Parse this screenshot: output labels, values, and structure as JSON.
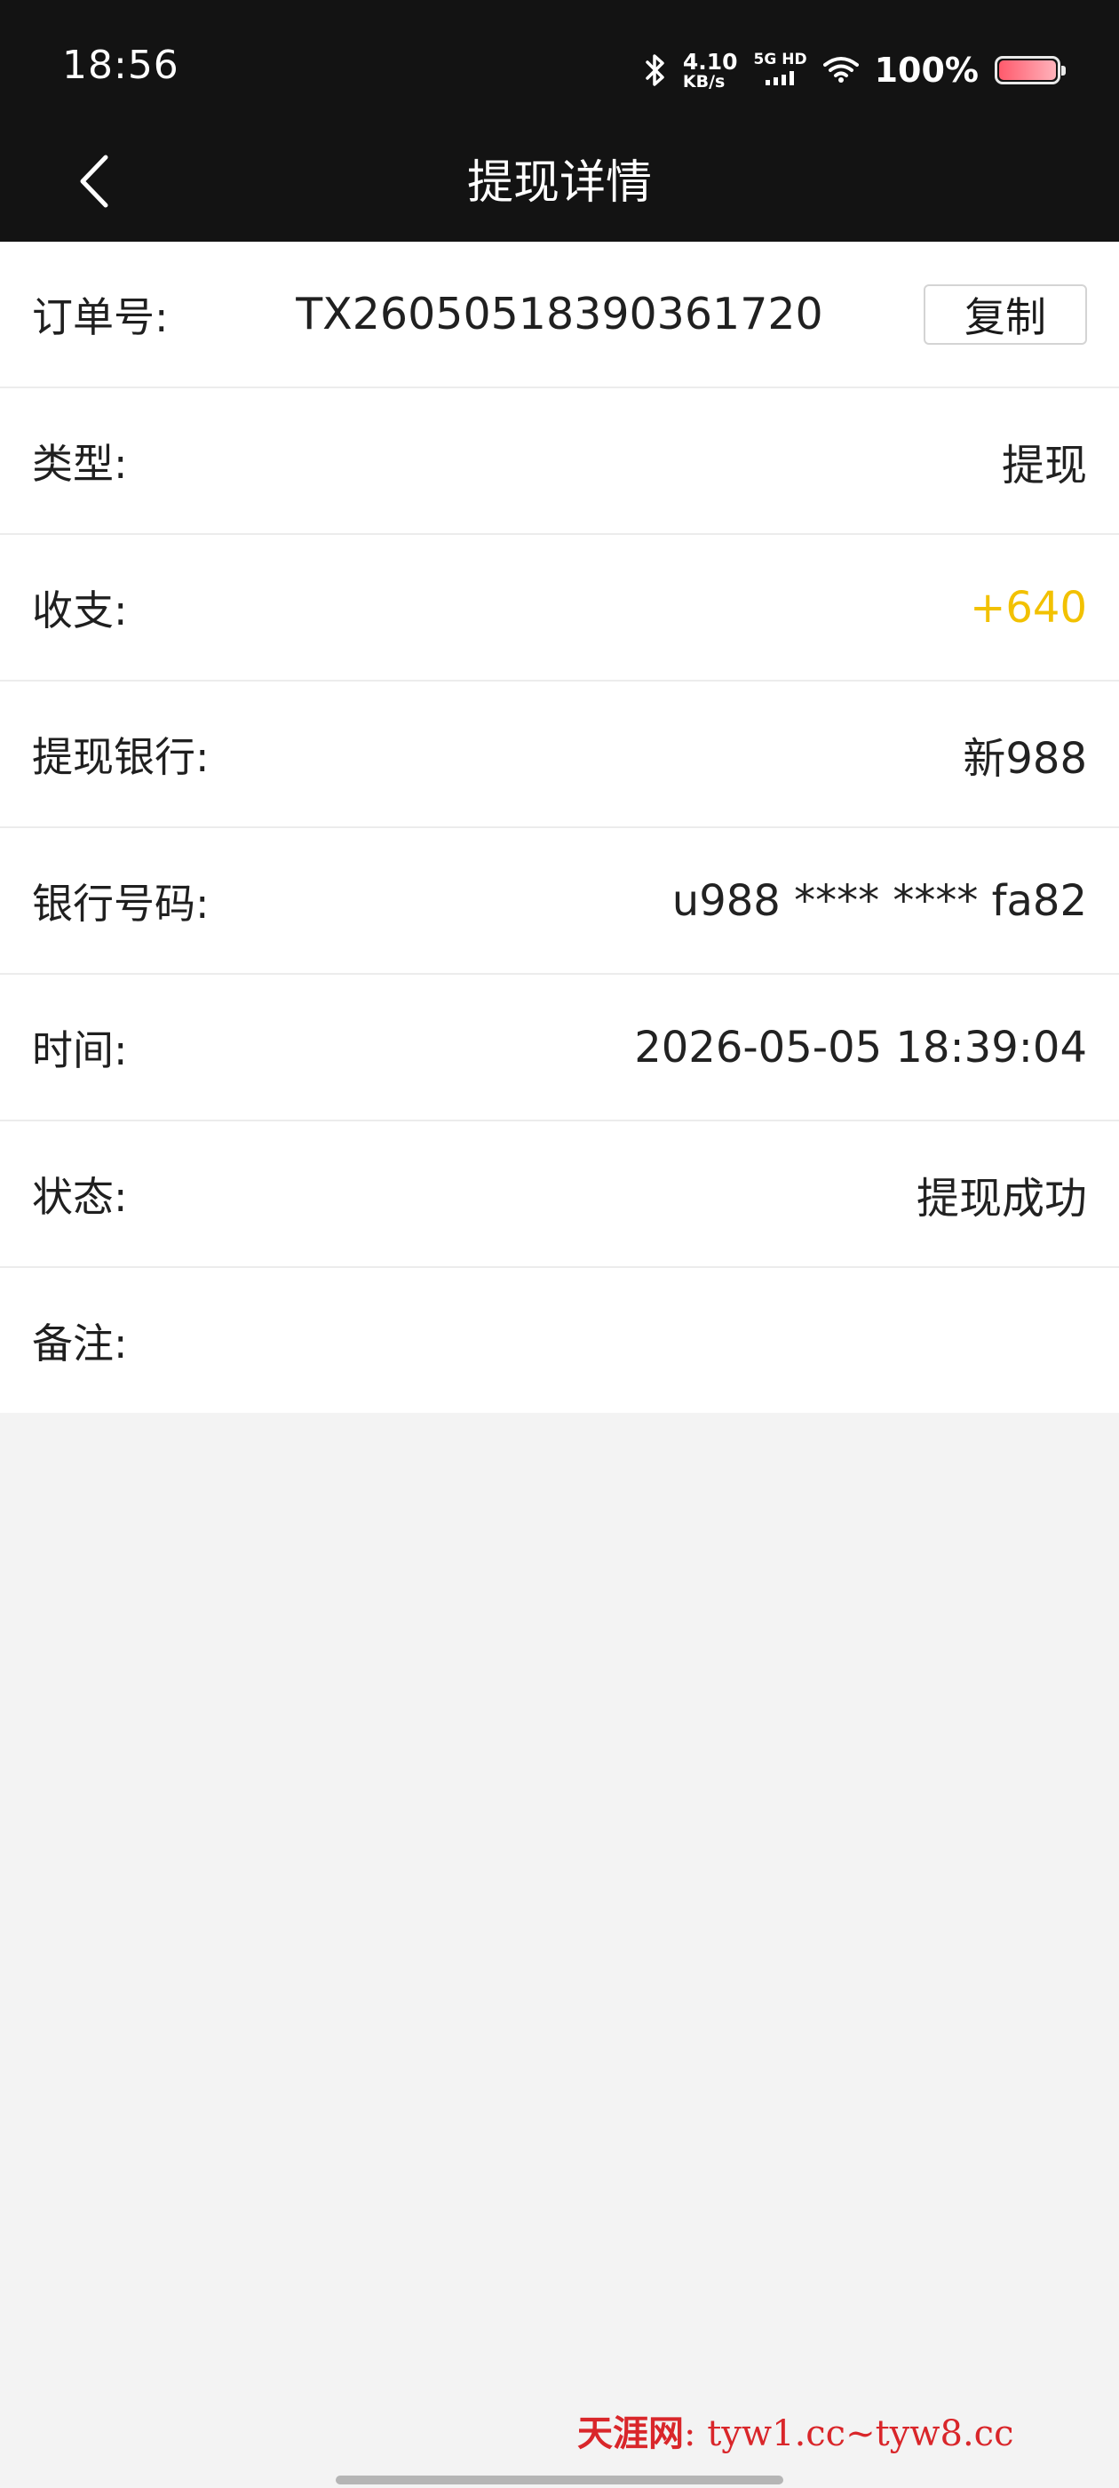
{
  "status_bar": {
    "time": "18:56",
    "net_speed_value": "4.10",
    "net_speed_unit": "KB/s",
    "signal_label": "5G HD",
    "battery_percent": "100%",
    "battery_level": 1.0,
    "icons": [
      "bluetooth-icon",
      "cellular-signal-icon",
      "wifi-icon",
      "battery-icon"
    ]
  },
  "header": {
    "title": "提现详情",
    "back_icon": "chevron-left-icon"
  },
  "details": {
    "order": {
      "label": "订单号:",
      "value": "TX26050518390361720",
      "copy_label": "复制"
    },
    "type": {
      "label": "类型:",
      "value": "提现"
    },
    "income_expense": {
      "label": "收支:",
      "value": "+640"
    },
    "bank": {
      "label": "提现银行:",
      "value": "新988"
    },
    "bank_number": {
      "label": "银行号码:",
      "value": "u988 **** **** fa82"
    },
    "time": {
      "label": "时间:",
      "value": "2026-05-05 18:39:04"
    },
    "status": {
      "label": "状态:",
      "value": "提现成功"
    },
    "remark": {
      "label": "备注:",
      "value": ""
    }
  },
  "watermark": {
    "brand": "天涯网",
    "separator": ":",
    "domains": "tyw1.cc~tyw8.cc"
  },
  "colors": {
    "header_bg": "#131313",
    "income_color": "#f2c100",
    "page_bg": "#f3f3f3",
    "watermark_color": "#d9262a"
  }
}
